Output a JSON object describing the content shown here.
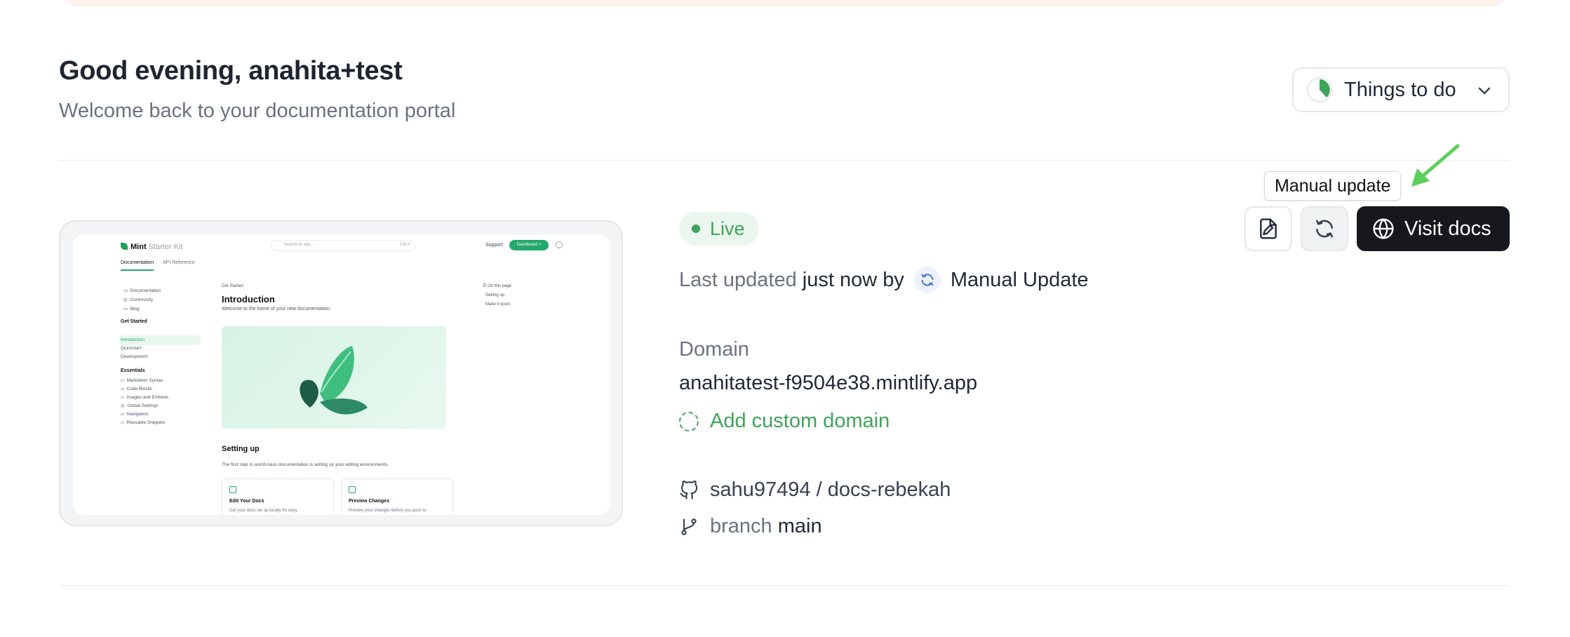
{
  "header": {
    "greeting": "Good evening, anahita+test",
    "subtitle": "Welcome back to your documentation portal",
    "todo_label": "Things to do"
  },
  "status": {
    "live_label": "Live",
    "last_updated_prefix": "Last updated",
    "last_updated_time": "just now by",
    "updated_by": "Manual Update"
  },
  "domain": {
    "label": "Domain",
    "value": "anahitatest-f9504e38.mintlify.app",
    "add_custom": "Add custom domain"
  },
  "repo": {
    "name": "sahu97494 / docs-rebekah",
    "branch_label": "branch",
    "branch_name": "main"
  },
  "actions": {
    "tooltip": "Manual update",
    "visit_label": "Visit docs"
  },
  "preview": {
    "logo": "Mint",
    "logo_sub": "Starter Kit",
    "search_placeholder": "Search or ask...",
    "search_shortcut": "Ctrl K",
    "support": "Support",
    "dashboard": "Dashboard >",
    "tabs": [
      "Documentation",
      "API Reference"
    ],
    "nav_links": [
      "Documentation",
      "Community",
      "Blog"
    ],
    "group1_title": "Get Started",
    "group1_items": [
      "Introduction",
      "Quickstart",
      "Development"
    ],
    "group2_title": "Essentials",
    "group2_items": [
      "Markdown Syntax",
      "Code Blocks",
      "Images and Embeds",
      "Global Settings",
      "Navigation",
      "Reusable Snippets"
    ],
    "eyebrow": "Get Started",
    "title": "Introduction",
    "lead": "Welcome to the home of your new documentation",
    "section_title": "Setting up",
    "section_text": "The first step to world-class documentation is setting up your editing environments.",
    "card1_title": "Edit Your Docs",
    "card1_text": "Get your docs set up locally for easy",
    "card2_title": "Preview Changes",
    "card2_text": "Preview your changes before you push to",
    "toc_title": "On this page",
    "toc_items": [
      "Setting up",
      "Make it yours"
    ]
  },
  "colors": {
    "accent_green": "#3fa45a",
    "dark_button": "#16181d",
    "banner": "#fdf1ec"
  }
}
